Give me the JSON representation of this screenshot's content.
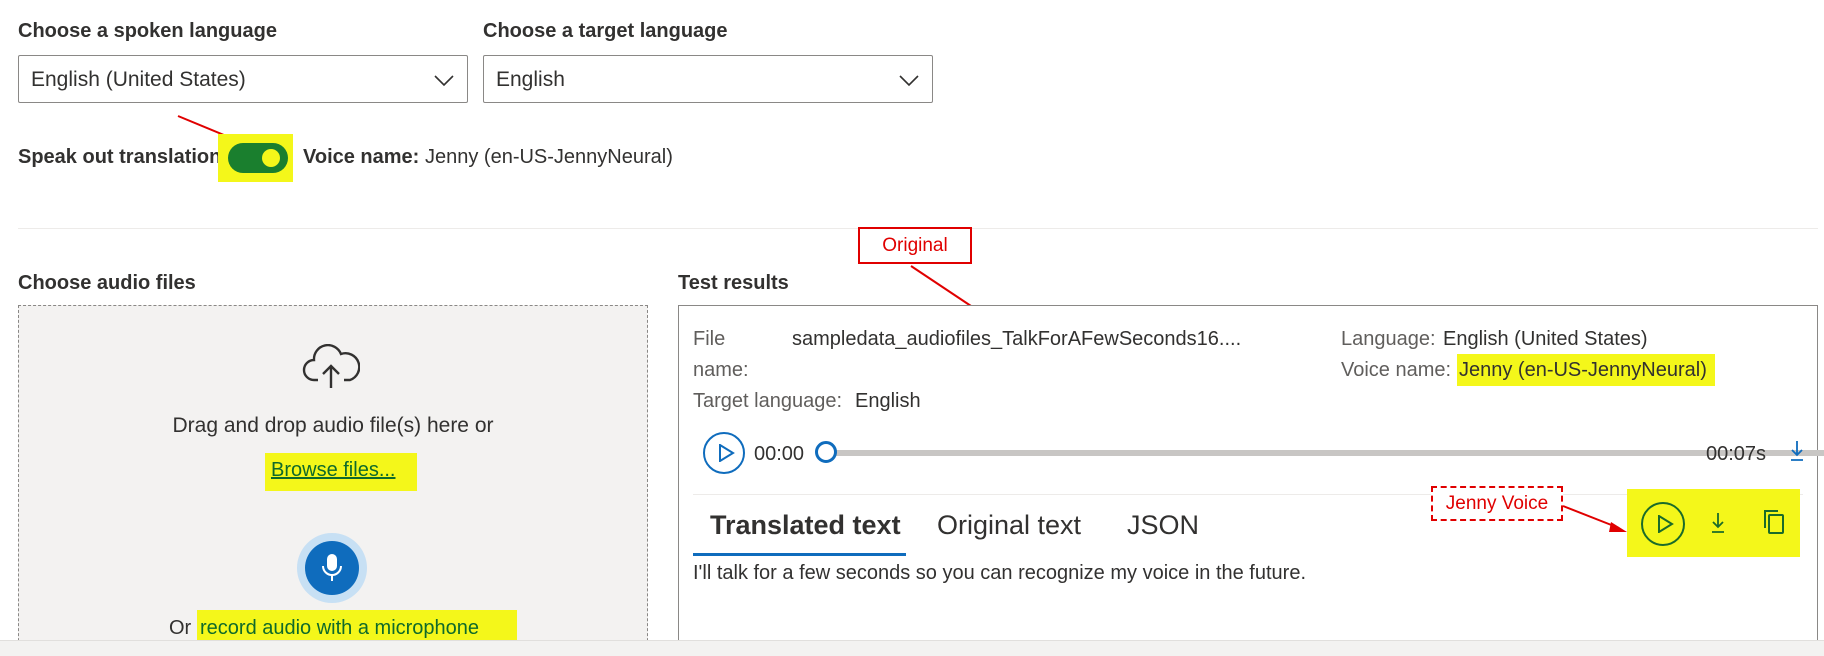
{
  "spoken_language": {
    "label": "Choose a spoken language",
    "value": "English (United States)"
  },
  "target_language": {
    "label": "Choose a target language",
    "value": "English"
  },
  "speak_out": {
    "label": "Speak out translation",
    "on": true,
    "voice_label": "Voice name:",
    "voice_value": "Jenny (en-US-JennyNeural)"
  },
  "audio_files": {
    "heading": "Choose audio files",
    "drag_text": "Drag and drop audio file(s) here or",
    "browse": "Browse files...",
    "or": "Or",
    "record": "record audio with a microphone"
  },
  "results": {
    "heading": "Test results",
    "file_key_1": "File",
    "file_key_2": "name:",
    "file_value": "sampledata_audiofiles_TalkForAFewSeconds16....",
    "language_key": "Language:",
    "language_value": "English (United States)",
    "voice_key": "Voice name:",
    "voice_value": "Jenny (en-US-JennyNeural)",
    "target_key": "Target language:",
    "target_value": "English",
    "player": {
      "current": "00:00",
      "duration": "00:07s",
      "progress": 0
    },
    "tabs": [
      "Translated text",
      "Original text",
      "JSON"
    ],
    "active_tab": 0,
    "translated": "I'll talk for a few seconds so you can recognize my voice in the future."
  },
  "annotations": {
    "original": "Original",
    "jenny": "Jenny Voice"
  },
  "colors": {
    "accent": "#0f6cbd",
    "highlight": "#f4f71a",
    "toggle": "#1a7f2e",
    "annotation": "#e00000"
  }
}
